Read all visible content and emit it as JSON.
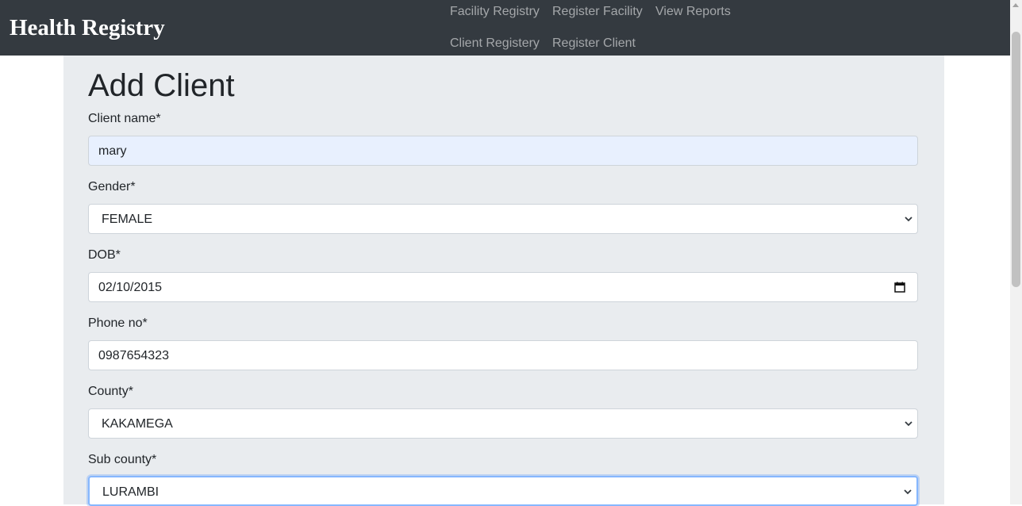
{
  "navbar": {
    "brand": "Health Registry",
    "links": [
      {
        "label": "Facility Registry"
      },
      {
        "label": "Register Facility"
      },
      {
        "label": "View Reports"
      },
      {
        "label": "Client Registery"
      },
      {
        "label": "Register Client"
      }
    ]
  },
  "form": {
    "title": "Add Client",
    "fields": [
      {
        "label": "Client name*",
        "value": "mary",
        "type": "text"
      },
      {
        "label": "Gender*",
        "value": "FEMALE",
        "type": "select"
      },
      {
        "label": "DOB*",
        "value": "02/10/2015",
        "type": "date"
      },
      {
        "label": "Phone no*",
        "value": "0987654323",
        "type": "text"
      },
      {
        "label": "County*",
        "value": "KAKAMEGA",
        "type": "select"
      },
      {
        "label": "Sub county*",
        "value": "LURAMBI",
        "type": "select"
      }
    ]
  },
  "icons": {
    "select_arrow": "chevron-down-icon",
    "date_picker": "calendar-icon"
  },
  "colors": {
    "navbar_bg": "#343a40",
    "form_bg": "#e9ecef",
    "autofill_bg": "#e8f0fe",
    "focus_border": "#86b7fe"
  }
}
